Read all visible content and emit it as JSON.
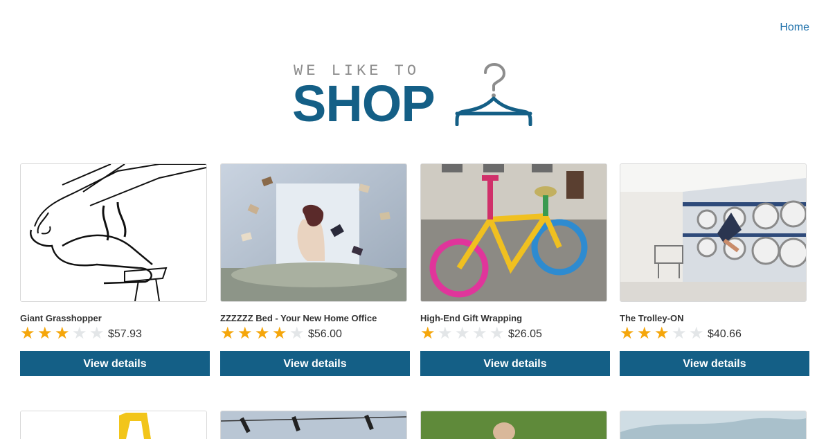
{
  "nav": {
    "home_label": "Home"
  },
  "logo": {
    "tagline": "WE LIKE TO",
    "word": "SHOP"
  },
  "colors": {
    "brand": "#145f86",
    "link": "#1b6faa",
    "star_on": "#f5a60b",
    "star_off": "#e3e6e8"
  },
  "products": [
    {
      "name": "Giant Grasshopper",
      "rating": 3,
      "max_rating": 5,
      "price": "$57.93",
      "button_label": "View details"
    },
    {
      "name": "ZZZZZZ Bed - Your New Home Office",
      "rating": 4,
      "max_rating": 5,
      "price": "$56.00",
      "button_label": "View details"
    },
    {
      "name": "High-End Gift Wrapping",
      "rating": 1,
      "max_rating": 5,
      "price": "$26.05",
      "button_label": "View details"
    },
    {
      "name": "The Trolley-ON",
      "rating": 3,
      "max_rating": 5,
      "price": "$40.66",
      "button_label": "View details"
    }
  ]
}
